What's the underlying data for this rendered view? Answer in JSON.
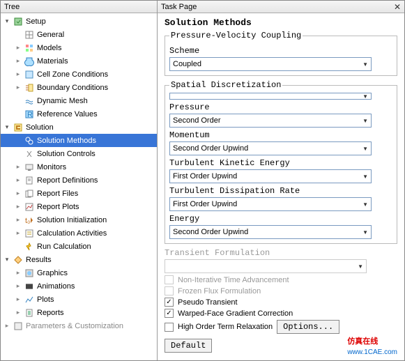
{
  "tree": {
    "header": "Tree",
    "setup": {
      "label": "Setup",
      "items": [
        "General",
        "Models",
        "Materials",
        "Cell Zone Conditions",
        "Boundary Conditions",
        "Dynamic Mesh",
        "Reference Values"
      ]
    },
    "solution": {
      "label": "Solution",
      "items": [
        "Solution Methods",
        "Solution Controls",
        "Monitors",
        "Report Definitions",
        "Report Files",
        "Report Plots",
        "Solution Initialization",
        "Calculation Activities",
        "Run Calculation"
      ]
    },
    "results": {
      "label": "Results",
      "items": [
        "Graphics",
        "Animations",
        "Plots",
        "Reports"
      ]
    },
    "params": "Parameters & Customization"
  },
  "task": {
    "header": "Task Page",
    "title": "Solution Methods",
    "pvc": {
      "legend": "Pressure-Velocity Coupling",
      "scheme_lbl": "Scheme",
      "scheme_val": "Coupled"
    },
    "sd": {
      "legend": "Spatial Discretization",
      "pressure_lbl": "Pressure",
      "pressure_val": "Second Order",
      "momentum_lbl": "Momentum",
      "momentum_val": "Second Order Upwind",
      "tke_lbl": "Turbulent Kinetic Energy",
      "tke_val": "First Order Upwind",
      "tdr_lbl": "Turbulent Dissipation Rate",
      "tdr_val": "First Order Upwind",
      "energy_lbl": "Energy",
      "energy_val": "Second Order Upwind"
    },
    "tf_lbl": "Transient Formulation",
    "ck_nita": "Non-Iterative Time Advancement",
    "ck_frozen": "Frozen Flux Formulation",
    "ck_pseudo": "Pseudo Transient",
    "ck_warped": "Warped-Face Gradient Correction",
    "ck_high": "High Order Term Relaxation",
    "options_btn": "Options...",
    "default_btn": "Default"
  },
  "wm": {
    "brand": "仿真在线",
    "url": "www.1CAE.com"
  }
}
